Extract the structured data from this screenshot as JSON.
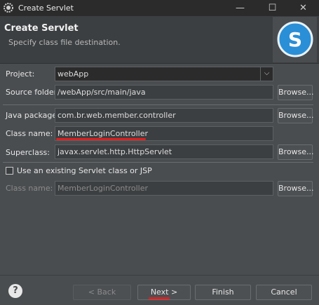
{
  "window": {
    "title": "Create Servlet",
    "minimize": "—",
    "maximize": "☐",
    "close": "✕"
  },
  "header": {
    "title": "Create Servlet",
    "subtitle": "Specify class file destination."
  },
  "form": {
    "project_label": "Project:",
    "project_value": "webApp",
    "source_folder_label": "Source folder:",
    "source_folder_value": "/webApp/src/main/java",
    "java_package_label": "Java package:",
    "java_package_value": "com.br.web.member.controller",
    "class_name_label": "Class name:",
    "class_name_value": "MemberLoginController",
    "superclass_label": "Superclass:",
    "superclass_value": "javax.servlet.http.HttpServlet",
    "use_existing_label": "Use an existing Servlet class or JSP",
    "existing_class_label": "Class name:",
    "existing_class_value": "MemberLoginController",
    "browse": "Browse..."
  },
  "footer": {
    "back": "< Back",
    "next": "Next >",
    "finish": "Finish",
    "cancel": "Cancel",
    "help": "?"
  },
  "colors": {
    "accent_red": "#e01f1f",
    "logo_blue": "#2a8fd6"
  }
}
